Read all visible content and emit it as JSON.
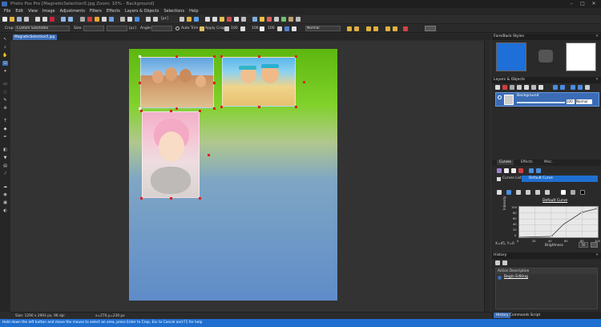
{
  "window": {
    "title": "Photo Pos Pro [MagneticSelection5.jpg Zoom: 10% - Background]"
  },
  "menu": [
    "File",
    "Edit",
    "View",
    "Image",
    "Adjustments",
    "Filters",
    "Effects",
    "Layers & Objects",
    "Selections",
    "Help"
  ],
  "toolbar": {
    "zoom": "[pc]"
  },
  "options": {
    "tool": "Crop:",
    "ratio": "Custom Size/Ratio",
    "size_label": "Size:",
    "unit": "[pc]",
    "angle_label": "Angle:",
    "auto_trim": "Auto Trim",
    "apply_crop": "Apply Crop",
    "val1": "100",
    "val2": "100",
    "val3": "100",
    "blend": "Normal"
  },
  "doc_tab": "MagneticSelection5.jpg",
  "status": {
    "size": "Size: 1290 x 2993 px, 96 dpi",
    "coords": "x=270,y=230 px"
  },
  "hint": "Hold down the left button and move the mouse to select an area, press Enter to Crop, Esc to Cancel and F1 for help",
  "panels": {
    "fore_back": {
      "title": "Fore/Back Styles"
    },
    "layers": {
      "title": "Layers & Objects",
      "layer_name": "Background",
      "opacity": "100",
      "mode": "Normal"
    },
    "tabs": {
      "curves": "Curves",
      "effects": "Effects",
      "misc": "Misc."
    },
    "curves": {
      "list_label": "Curves List",
      "selected": "Default Curve",
      "plot_title": "Default Curve",
      "y_axis": "Intensity",
      "x_axis": "Brightness",
      "xy_readout": "X=45, Y=0",
      "x_ticks": [
        "0",
        "20",
        "40",
        "60",
        "80",
        "100"
      ],
      "y_ticks": [
        "100",
        "80",
        "60",
        "40",
        "20",
        "0"
      ],
      "value": "50"
    },
    "history": {
      "title": "History",
      "header": "Action Description",
      "item": "Begin Editing"
    },
    "bottom_tabs": {
      "history": "History",
      "commands": "Commands Script"
    }
  },
  "colors": {
    "accent": "#3b6cb5",
    "statusbar": "#1f6fd0",
    "foreground": "#1f6fd8",
    "background": "#ffffff"
  }
}
